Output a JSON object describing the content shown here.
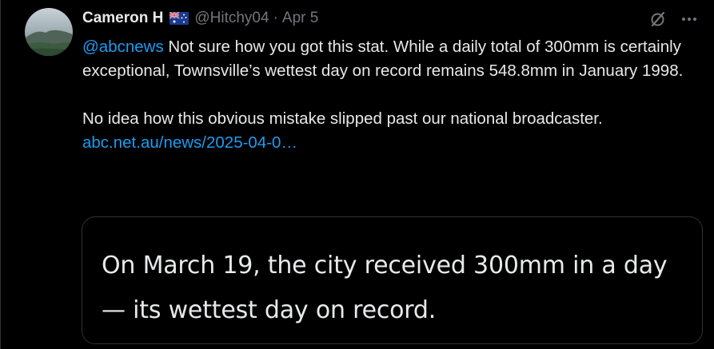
{
  "tweet": {
    "author_name": "Cameron H",
    "flag_icon": "australian-flag-icon",
    "handle": "@Hitchy04",
    "separator": "·",
    "date": "Apr 5",
    "actions": [
      "grok-icon",
      "more-icon"
    ],
    "mention": "@abcnews",
    "paragraph1_rest": " Not sure how you got this stat. While a daily total of 300mm is certainly exceptional, Townsville’s wettest day on record remains 548.8mm in January 1998.",
    "paragraph2": "No idea how this obvious mistake slipped past our national broadcaster.",
    "link_text": "abc.net.au/news/2025-04-0…"
  },
  "card": {
    "text": "On March 19, the city received 300mm in a day — its wettest day on record."
  },
  "colors": {
    "background": "#000000",
    "text": "#e7e9ea",
    "secondary_text": "#71767b",
    "link": "#1d9bf0",
    "border": "#2f3336"
  }
}
